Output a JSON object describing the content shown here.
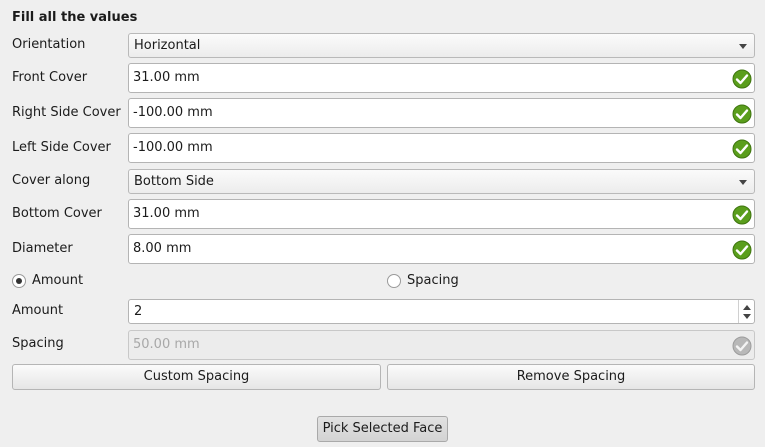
{
  "section_title": "Fill all the values",
  "orientation": {
    "label": "Orientation",
    "value": "Horizontal"
  },
  "front_cover": {
    "label": "Front Cover",
    "value": "31.00 mm"
  },
  "right_side_cover": {
    "label": "Right Side Cover",
    "value": "-100.00 mm"
  },
  "left_side_cover": {
    "label": "Left Side Cover",
    "value": "-100.00 mm"
  },
  "cover_along": {
    "label": "Cover along",
    "value": "Bottom Side"
  },
  "bottom_cover": {
    "label": "Bottom Cover",
    "value": "31.00 mm"
  },
  "diameter": {
    "label": "Diameter",
    "value": "8.00 mm"
  },
  "mode": {
    "amount_label": "Amount",
    "spacing_label": "Spacing",
    "selected": "Amount"
  },
  "amount": {
    "label": "Amount",
    "value": "2"
  },
  "spacing": {
    "label": "Spacing",
    "value": "50.00 mm",
    "enabled": false
  },
  "buttons": {
    "custom_spacing": "Custom Spacing",
    "remove_spacing": "Remove Spacing",
    "pick_selected_face": "Pick Selected Face"
  },
  "colors": {
    "valid_check": "#5a9e1c",
    "disabled_check": "#b8b8b8",
    "background": "#efefef"
  }
}
